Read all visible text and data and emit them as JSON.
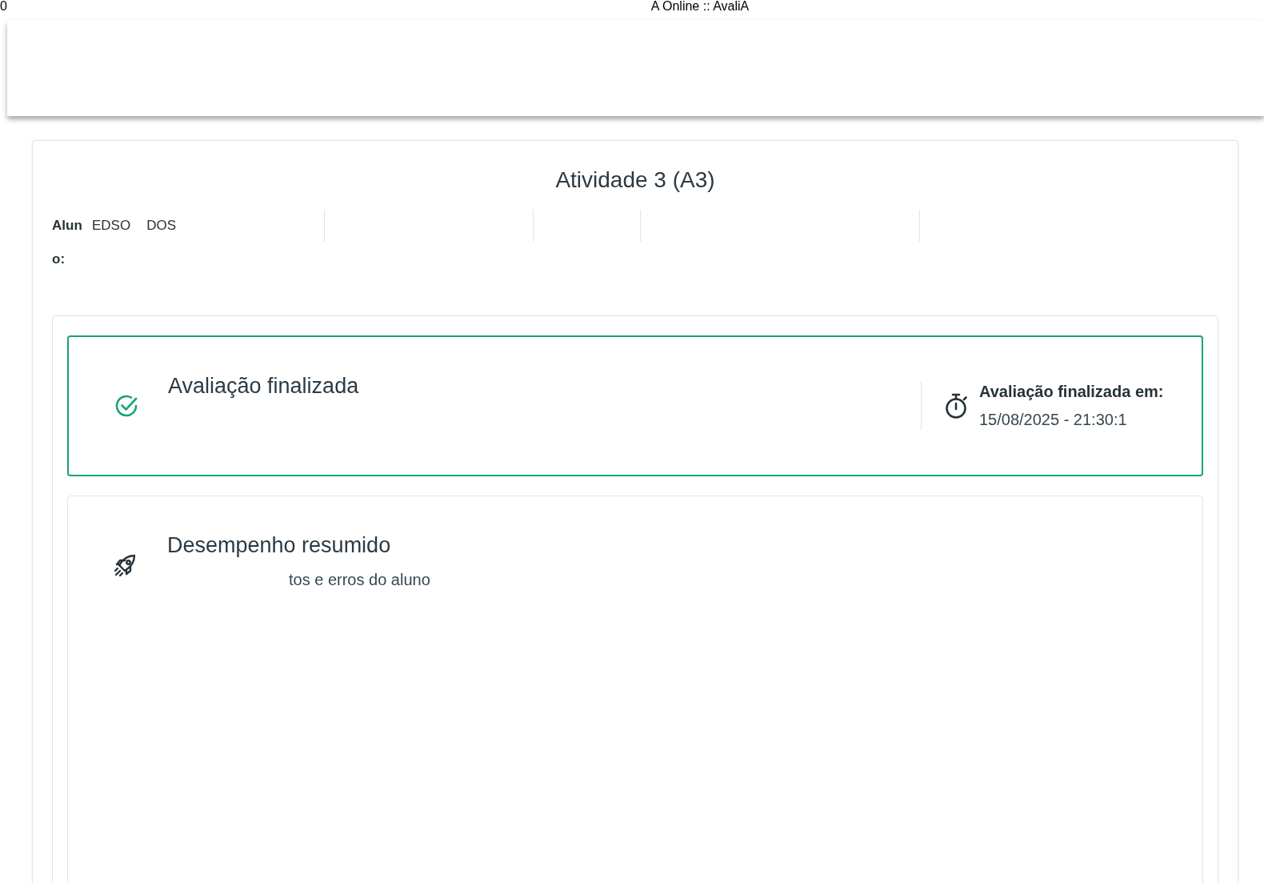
{
  "print_header": {
    "page_number": "0",
    "title": "A Online :: AvaliA"
  },
  "activity": {
    "title": "Atividade 3 (A3)",
    "student_label": "Aluno:",
    "student_name_parts": [
      "EDSO",
      "DOS"
    ]
  },
  "status_card": {
    "title": "Avaliação finalizada",
    "finished_label": "Avaliação finalizada em:",
    "finished_at": "15/08/2025 - 21:30:1"
  },
  "summary_card": {
    "title": "Desempenho resumido",
    "subtitle": "tos e erros do aluno"
  }
}
